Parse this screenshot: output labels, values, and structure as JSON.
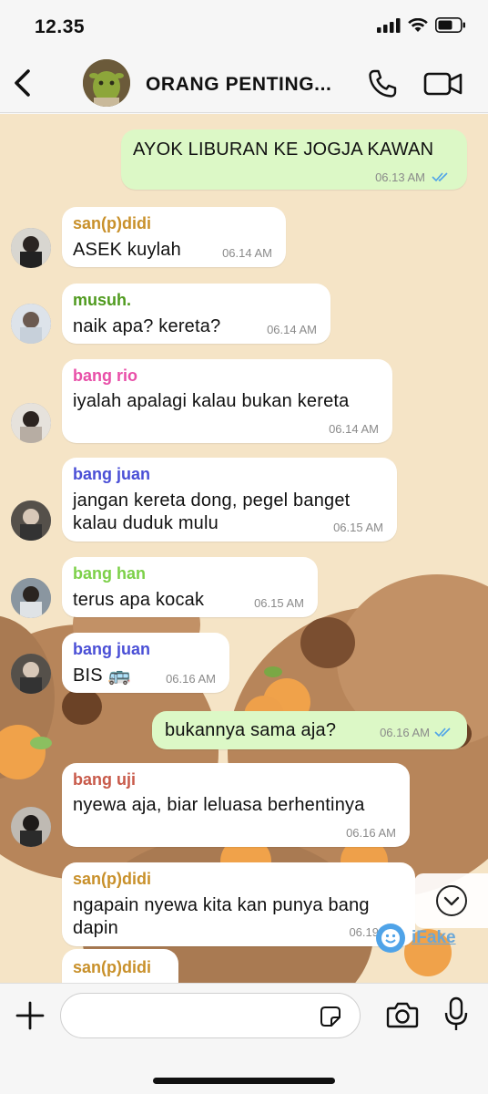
{
  "status_bar": {
    "time": "12.35"
  },
  "header": {
    "title": "ORANG PENTING..."
  },
  "messages": [
    {
      "direction": "out",
      "text": "AYOK LIBURAN KE JOGJA KAWAN",
      "time": "06.13 AM",
      "read": true
    },
    {
      "direction": "in",
      "sender": "san(p)didi",
      "sender_color": "#c8902a",
      "text": "ASEK kuylah",
      "time": "06.14 AM"
    },
    {
      "direction": "in",
      "sender": "musuh.",
      "sender_color": "#4f9a1e",
      "text": "naik apa? kereta?",
      "time": "06.14 AM"
    },
    {
      "direction": "in",
      "sender": "bang rio",
      "sender_color": "#e84fa8",
      "text": "iyalah apalagi kalau bukan kereta",
      "time": "06.14 AM"
    },
    {
      "direction": "in",
      "sender": "bang juan",
      "sender_color": "#4a4fd6",
      "text_line1": "jangan kereta dong, pegel banget",
      "text_line2": "kalau duduk mulu",
      "time": "06.15 AM"
    },
    {
      "direction": "in",
      "sender": "bang han",
      "sender_color": "#7cd048",
      "text": "terus apa kocak",
      "time": "06.15 AM"
    },
    {
      "direction": "in",
      "sender": "bang juan",
      "sender_color": "#4a4fd6",
      "text": "BIS 🚌",
      "time": "06.16 AM"
    },
    {
      "direction": "out",
      "text": "bukannya sama aja?",
      "time": "06.16 AM",
      "read": true
    },
    {
      "direction": "in",
      "sender": "bang uji",
      "sender_color": "#c85a4a",
      "text": "nyewa aja, biar leluasa berhentinya",
      "time": "06.16 AM"
    },
    {
      "direction": "in",
      "sender": "san(p)didi",
      "sender_color": "#c8902a",
      "text_line1": "ngapain nyewa kita kan punya bang",
      "text_line2": "dapin",
      "time": "06.19"
    },
    {
      "direction": "in",
      "sender": "san(p)didi",
      "sender_color": "#c8902a"
    }
  ],
  "watermark": "iFake",
  "icons": {
    "back": "chevron-left-icon",
    "call": "phone-icon",
    "video": "video-camera-icon",
    "plus": "plus-icon",
    "sticker": "sticker-icon",
    "camera": "camera-icon",
    "mic": "microphone-icon",
    "scroll": "chevron-down-icon",
    "ticks": "double-check-icon"
  },
  "colors": {
    "outgoing_bubble": "#dcf8c6",
    "incoming_bubble": "#ffffff",
    "read_ticks": "#4fa3e8",
    "wallpaper": "#f4e2c4"
  }
}
